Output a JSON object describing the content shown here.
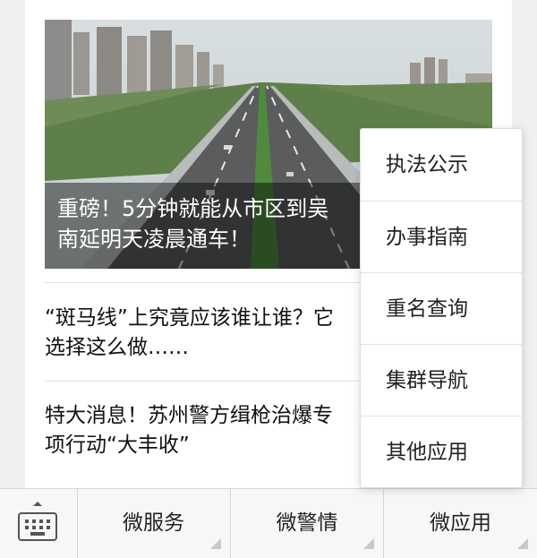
{
  "feed": {
    "hero": {
      "title": "重磅！5分钟就能从市区到吴\n南延明天凌晨通车！"
    },
    "articles": [
      {
        "title": "“斑马线”上究竟应该谁让谁？它\n选择这么做……"
      },
      {
        "title": "特大消息！苏州警方缉枪治爆专\n项行动“大丰收”"
      }
    ]
  },
  "popup_menu": {
    "items": [
      {
        "label": "执法公示"
      },
      {
        "label": "办事指南"
      },
      {
        "label": "重名查询"
      },
      {
        "label": "集群导航"
      },
      {
        "label": "其他应用"
      }
    ]
  },
  "bottom_bar": {
    "keyboard_icon": "keyboard-icon",
    "tabs": [
      {
        "label": "微服务"
      },
      {
        "label": "微警情"
      },
      {
        "label": "微应用"
      }
    ]
  },
  "colors": {
    "background": "#f0f0f0",
    "card": "#ffffff",
    "caption_overlay": "rgba(0,0,0,0.45)"
  }
}
